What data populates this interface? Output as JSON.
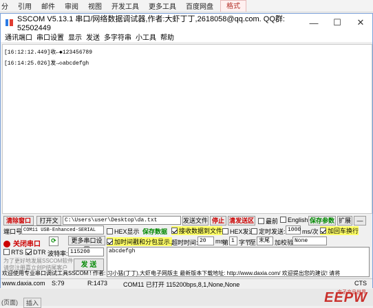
{
  "host_ribbon": {
    "tabs": [
      "引用",
      "邮件",
      "审阅",
      "视图",
      "开发工具",
      "更多工具",
      "百度网盘",
      "格式"
    ],
    "leading": "分"
  },
  "window": {
    "title": "SSCOM V5.13.1 串口/网络数据调试器,作者:大虾丁丁,2618058@qq.com. QQ群: 52502449",
    "minimize": "—",
    "maximize": "☐",
    "close": "✕"
  },
  "menu": [
    "通讯端口",
    "串口设置",
    "显示",
    "发送",
    "多字符串",
    "小工具",
    "帮助"
  ],
  "receive": {
    "lines": [
      "[16:12:12.449]收←◆123456789",
      "[16:14:25.026]发→◇abcdefgh"
    ]
  },
  "row1": {
    "clear": "清除窗口",
    "open_file": "打开文件",
    "path": "C:\\Users\\user\\Desktop\\da.txt",
    "send_file": "发送文件",
    "stop": "停止",
    "clear_send": "清发送区",
    "latest": "最前",
    "english": "English",
    "save_params": "保存参数",
    "expand": "扩展",
    "collapse": "—"
  },
  "row2": {
    "port_label": "端口号",
    "port_value": "COM11 USB-Enhanced-SERIAL",
    "hex_show": "HEX显示",
    "save_data": "保存数据",
    "recv_to_file": "接收数据到文件",
    "hex_send": "HEX发送",
    "timed_send": "定时发送:",
    "interval": "1000",
    "unit": "ms/次",
    "add_crlf": "加回车换行"
  },
  "row3": {
    "close_port": "关闭串口",
    "more_settings": "更多串口设置",
    "timestamp": "加时间戳和分包显示.",
    "timeout_label": "超时时间:",
    "timeout": "20",
    "ms": "ms",
    "nth": "第",
    "byte_n": "1",
    "byte_unit": "字节",
    "to": "至",
    "end": "末尾",
    "checksum": "加校验",
    "checksum_value": "None"
  },
  "row4": {
    "rts": "RTS",
    "dtr": "DTR",
    "baud_label": "波特率:",
    "baud": "115200",
    "send_text": "abcdefgh"
  },
  "promo": {
    "line1": "为了更好地发展SSCOM软件",
    "line2": "请您注册嘉立创P结尾客户",
    "send": "发 送"
  },
  "ticker": "欢迎使用专业串口调试工具SSCOM !   作者: 习小猛(丁丁),大虾电子网版主   最新版本下载地址: http://www.daxia.com/  欢迎提出您的建议! 请将",
  "status": {
    "site": "www.daxia.com",
    "s": "S:79",
    "r": "R:1473",
    "port": "COM11 已打开  115200bps,8,1,None,None",
    "cts": "CTS"
  },
  "host_bottom": {
    "left": "(页面)",
    "insert": "插入",
    "brand": "EEPW",
    "brand_cn": "电子产品世界"
  },
  "colors": {
    "accent": "#c00000",
    "highlight": "#ffff66",
    "green": "#008000"
  }
}
